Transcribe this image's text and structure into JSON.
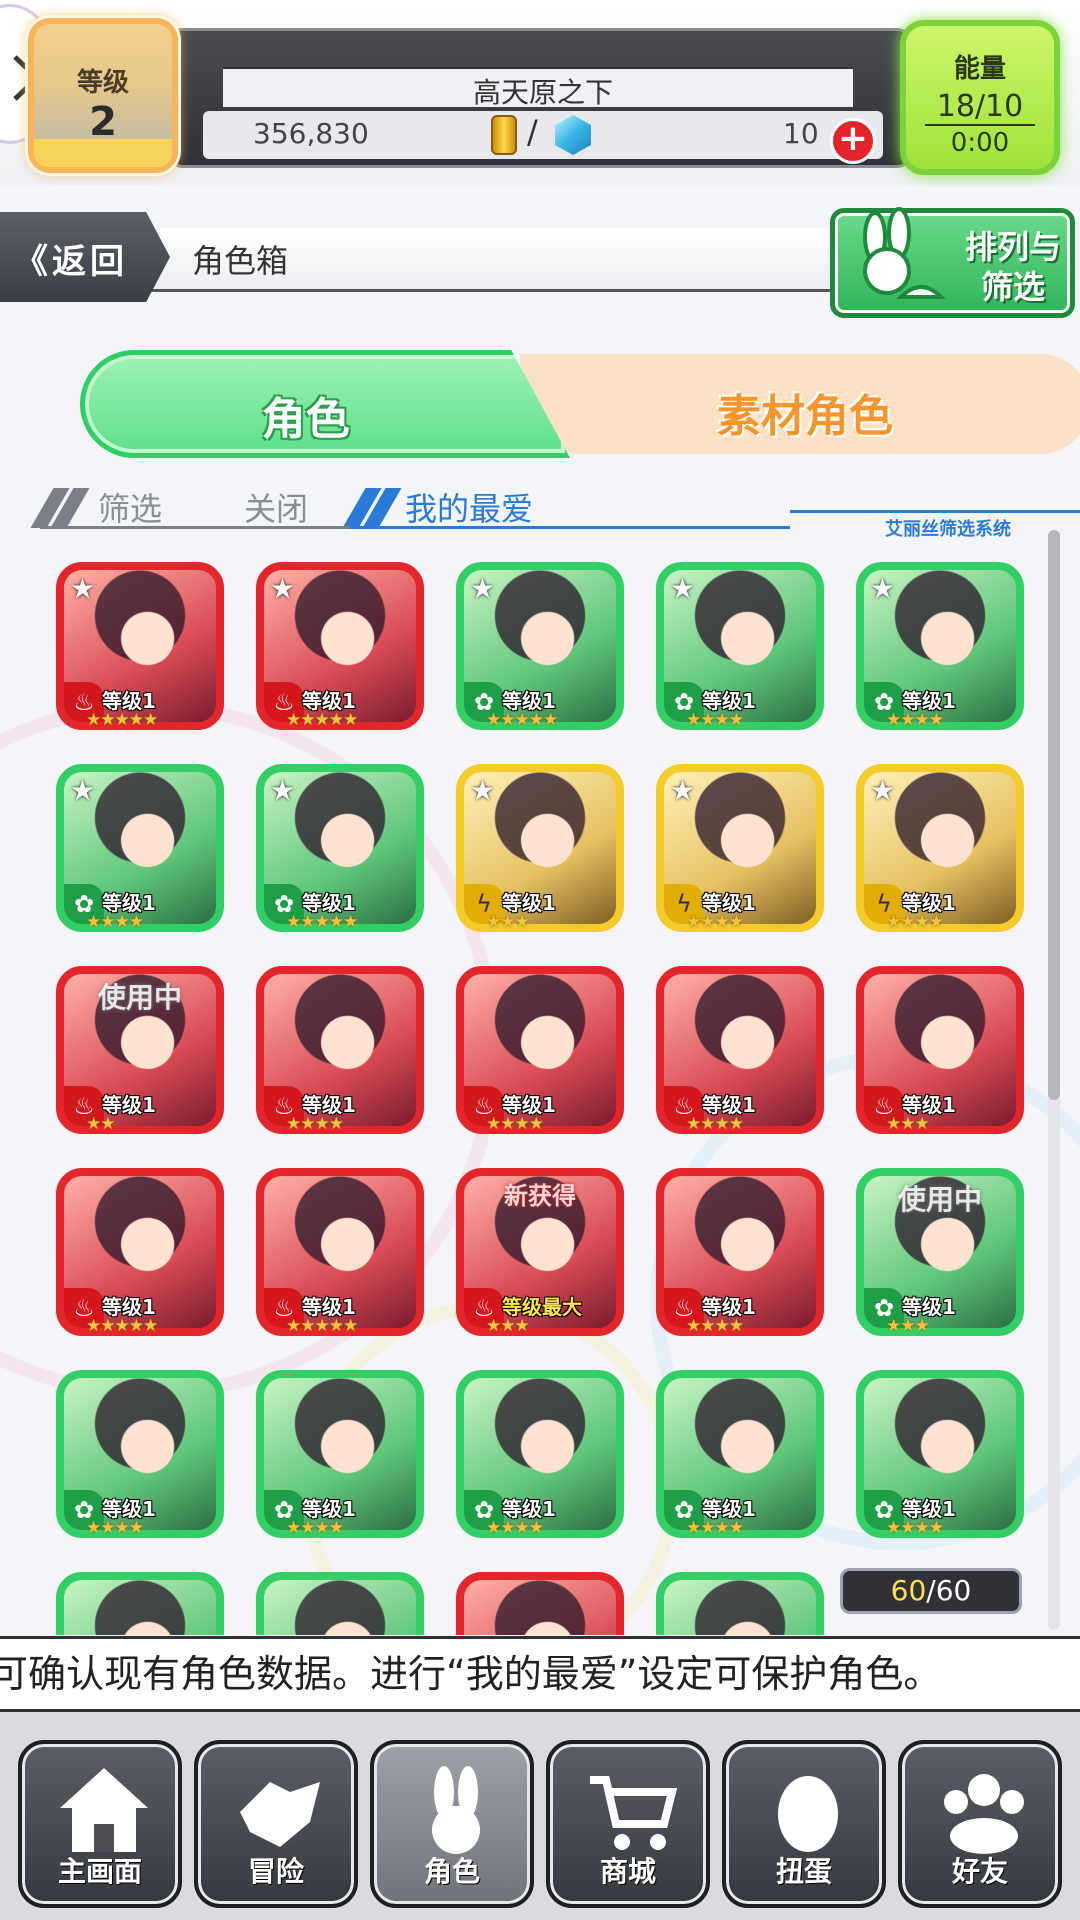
{
  "header": {
    "level_label": "等级",
    "level_value": "2",
    "player_name": "高天原之下",
    "gold": "356,830",
    "currency_separator": "/",
    "gems": "10",
    "energy_label": "能量",
    "energy_value": "18/10",
    "energy_timer": "0:00"
  },
  "nav_header": {
    "back_label": "返回",
    "page_title": "角色箱",
    "sort_label": "排列与筛选"
  },
  "tabs": {
    "characters": "角色",
    "materials": "素材角色"
  },
  "filter": {
    "filter_label": "筛选",
    "close_label": "关闭",
    "favorites_label": "我的最爱",
    "system_label": "艾丽丝筛选系统"
  },
  "colors": {
    "fire": "#e3262b",
    "wood": "#33cf66",
    "thunder": "#f3cb2a"
  },
  "cards": [
    {
      "element": "fire",
      "level": "等级1",
      "stars": "★★★★★",
      "fav": true
    },
    {
      "element": "fire",
      "level": "等级1",
      "stars": "★★★★★",
      "fav": true
    },
    {
      "element": "wood",
      "level": "等级1",
      "stars": "★★★★★",
      "fav": true
    },
    {
      "element": "wood",
      "level": "等级1",
      "stars": "★★★★",
      "fav": true
    },
    {
      "element": "wood",
      "level": "等级1",
      "stars": "★★★★",
      "fav": true
    },
    {
      "element": "wood",
      "level": "等级1",
      "stars": "★★★★",
      "fav": true
    },
    {
      "element": "wood",
      "level": "等级1",
      "stars": "★★★★★",
      "fav": true
    },
    {
      "element": "thunder",
      "level": "等级1",
      "stars": "★★★",
      "fav": true
    },
    {
      "element": "thunder",
      "level": "等级1",
      "stars": "★★★★",
      "fav": true
    },
    {
      "element": "thunder",
      "level": "等级1",
      "stars": "★★★★",
      "fav": true
    },
    {
      "element": "fire",
      "level": "等级1",
      "stars": "★★",
      "tag": "使用中"
    },
    {
      "element": "fire",
      "level": "等级1",
      "stars": "★★★★"
    },
    {
      "element": "fire",
      "level": "等级1",
      "stars": "★★★★"
    },
    {
      "element": "fire",
      "level": "等级1",
      "stars": "★★★★"
    },
    {
      "element": "fire",
      "level": "等级1",
      "stars": "★★★"
    },
    {
      "element": "fire",
      "level": "等级1",
      "stars": "★★★★★"
    },
    {
      "element": "fire",
      "level": "等级1",
      "stars": "★★★★★"
    },
    {
      "element": "fire",
      "level": "等级最大",
      "stars": "★★★",
      "tag": "新获得",
      "max": true
    },
    {
      "element": "fire",
      "level": "等级1",
      "stars": "★★★★"
    },
    {
      "element": "wood",
      "level": "等级1",
      "stars": "★★★",
      "tag": "使用中"
    },
    {
      "element": "wood",
      "level": "等级1",
      "stars": "★★★★"
    },
    {
      "element": "wood",
      "level": "等级1",
      "stars": "★★★★"
    },
    {
      "element": "wood",
      "level": "等级1",
      "stars": "★★★★"
    },
    {
      "element": "wood",
      "level": "等级1",
      "stars": "★★★★"
    },
    {
      "element": "wood",
      "level": "等级1",
      "stars": "★★★★"
    },
    {
      "element": "wood"
    },
    {
      "element": "wood"
    },
    {
      "element": "fire"
    },
    {
      "element": "wood"
    }
  ],
  "count": {
    "current": "60",
    "separator": "/",
    "max": "60"
  },
  "info_text": "可确认现有角色数据。进行“我的最爱”设定可保护角色。",
  "bottom_nav": [
    {
      "label": "主画面",
      "icon": "home-icon"
    },
    {
      "label": "冒险",
      "icon": "handshake-icon"
    },
    {
      "label": "角色",
      "icon": "bunny-icon",
      "active": true
    },
    {
      "label": "商城",
      "icon": "cart-icon"
    },
    {
      "label": "扭蛋",
      "icon": "egg-icon"
    },
    {
      "label": "好友",
      "icon": "friends-icon"
    }
  ]
}
